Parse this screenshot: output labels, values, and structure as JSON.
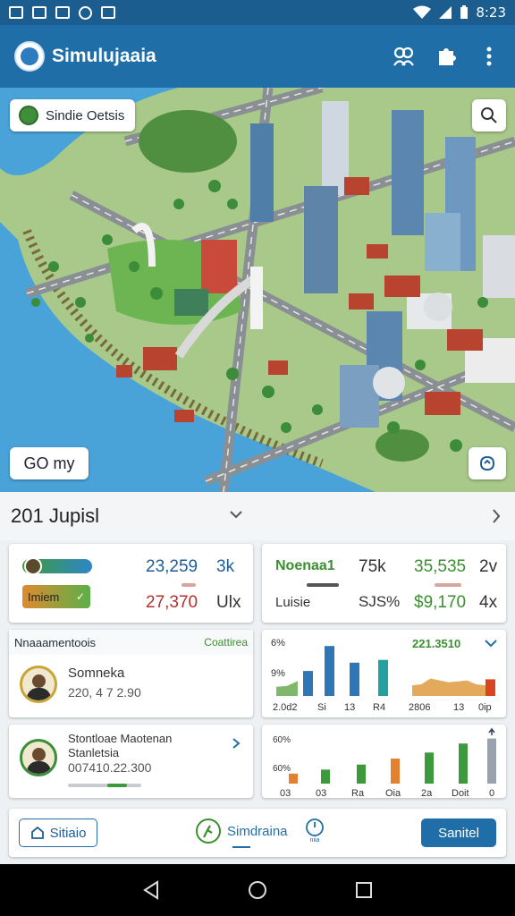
{
  "status": {
    "time": "8:23"
  },
  "app": {
    "title": "Simulujaaia"
  },
  "map": {
    "chip_label": "Sindie Oetsis",
    "zoom_label": "GO my"
  },
  "section": {
    "title": "201 Jupisl"
  },
  "stats_left": {
    "select_label": "Imiem",
    "row1_value": "23,259",
    "row1_unit": "3k",
    "row2_value": "27,370",
    "row2_unit": "Ulx"
  },
  "stats_right": {
    "label": "Noenaa1",
    "sublabel": "Luisie",
    "row1_value": "75k",
    "row1_value2": "35,535",
    "row1_unit": "2v",
    "row2_value": "SJS%",
    "row2_value2": "$9,170",
    "row2_unit": "4x"
  },
  "list": {
    "header": "Nnaaamentoois",
    "header_action": "Coattirea",
    "items": [
      {
        "name": "Somneka",
        "detail": "220, 4 7 2.90"
      },
      {
        "name_line1": "Stontloae Maotenan",
        "name_line2": "Stanletsia",
        "detail": "007410.22.300"
      }
    ]
  },
  "chart_data": [
    {
      "type": "area",
      "x_ticks": [
        "2.0d2",
        "Si",
        "13",
        "R4",
        "2806",
        "13",
        "0ip"
      ],
      "y_ticks": [
        "6%",
        "9%"
      ],
      "value_label": "221.3510",
      "series": [
        {
          "values": [
            55,
            60,
            90,
            80,
            70,
            75,
            80,
            60,
            55,
            50
          ]
        }
      ],
      "bars": [
        {
          "value": 45,
          "color": "#2e76b6"
        },
        {
          "value": 90,
          "color": "#2e76b6"
        },
        {
          "value": 60,
          "color": "#2e76b6"
        },
        {
          "value": 65,
          "color": "#24a0a0"
        },
        {
          "value": 30,
          "color": "#d8451f"
        }
      ],
      "ylim": [
        0,
        100
      ]
    },
    {
      "type": "bar",
      "categories": [
        "03",
        "03",
        "Ra",
        "Oia",
        "2a",
        "Doit",
        "0"
      ],
      "y_ticks": [
        "60%",
        "60%"
      ],
      "values": [
        20,
        28,
        38,
        50,
        62,
        80,
        90
      ],
      "colors": [
        "#e0822f",
        "#3c9a3c",
        "#3c9a3c",
        "#e0822f",
        "#3c9a3c",
        "#3c9a3c",
        "#9aa3ad"
      ],
      "ylim": [
        0,
        100
      ]
    }
  ],
  "actions": {
    "left_button": "Sitiaio",
    "middle_label": "Simdraina",
    "middle_small": "niia",
    "primary_button": "Sanitel"
  },
  "colors": {
    "primary": "#1f6ea8",
    "accent_green": "#3c8f30",
    "accent_red": "#b5302d"
  }
}
